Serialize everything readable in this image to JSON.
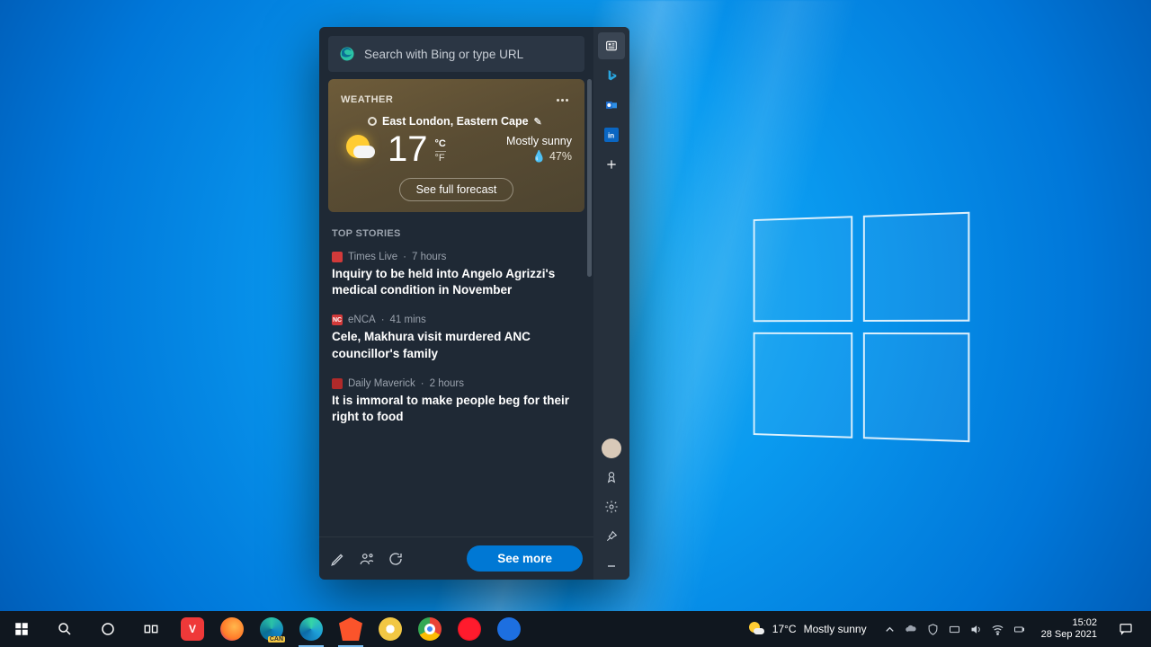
{
  "search": {
    "placeholder": "Search with Bing or type URL"
  },
  "sidebar_icons": [
    "news",
    "bing",
    "outlook",
    "linkedin",
    "add",
    "profile",
    "rewards",
    "settings",
    "pin",
    "collapse"
  ],
  "weather": {
    "section_title": "WEATHER",
    "location": "East London, Eastern Cape",
    "temperature": "17",
    "unit_c": "°C",
    "unit_f": "°F",
    "condition": "Mostly sunny",
    "humidity": "47%",
    "forecast_btn": "See full forecast"
  },
  "stories": {
    "section_title": "TOP STORIES",
    "items": [
      {
        "source": "Times Live",
        "age": "7 hours",
        "badge_bg": "#d23a3a",
        "badge_txt": "",
        "headline": "Inquiry to be held into Angelo Agrizzi's medical condition in November"
      },
      {
        "source": "eNCA",
        "age": "41 mins",
        "badge_bg": "#d23a3a",
        "badge_txt": "NC",
        "headline": "Cele, Makhura visit murdered ANC councillor's family"
      },
      {
        "source": "Daily Maverick",
        "age": "2 hours",
        "badge_bg": "#b02a2a",
        "badge_txt": "",
        "headline": "It is immoral to make people beg for their right to food"
      }
    ],
    "see_more": "See more"
  },
  "taskbar": {
    "weather": {
      "temp": "17°C",
      "cond": "Mostly sunny"
    },
    "clock": {
      "time": "15:02",
      "date": "28 Sep 2021"
    }
  }
}
